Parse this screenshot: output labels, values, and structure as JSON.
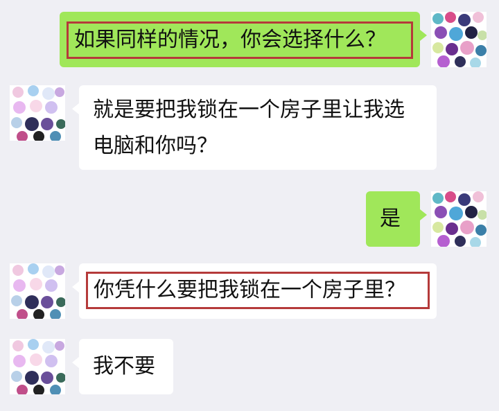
{
  "chat": {
    "messages": [
      {
        "side": "out",
        "text": "如果同样的情况，你会选择什么？",
        "highlighted": true
      },
      {
        "side": "in",
        "lines": [
          "就是要把我锁在一个房子里让我选",
          "电脑和你吗？"
        ],
        "highlighted": false
      },
      {
        "side": "out",
        "text": "是",
        "highlighted": false
      },
      {
        "side": "in",
        "text": "你凭什么要把我锁在一个房子里？",
        "highlighted": true
      },
      {
        "side": "in",
        "text": "我不要",
        "highlighted": false
      }
    ]
  },
  "colors": {
    "background": "#efeff4",
    "outgoing_bubble": "#a0e75a",
    "incoming_bubble": "#ffffff",
    "highlight_border": "#b53a3a"
  },
  "icons": {
    "self_avatar": "pixelated-avatar-icon",
    "other_avatar": "pixelated-avatar-icon"
  }
}
